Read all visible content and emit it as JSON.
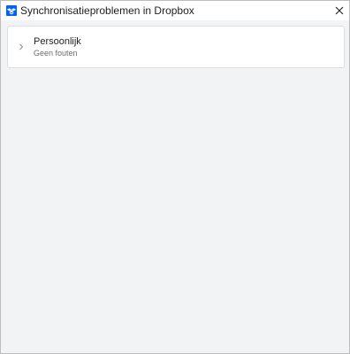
{
  "window": {
    "title": "Synchronisatieproblemen in Dropbox",
    "app_icon": "dropbox-app-icon",
    "close_icon": "close-icon"
  },
  "accounts": [
    {
      "name": "Persoonlijk",
      "status": "Geen fouten",
      "expand_icon": "chevron-right-icon"
    }
  ],
  "colors": {
    "brand": "#0061fe",
    "background": "#f2f3f5",
    "card": "#ffffff"
  }
}
